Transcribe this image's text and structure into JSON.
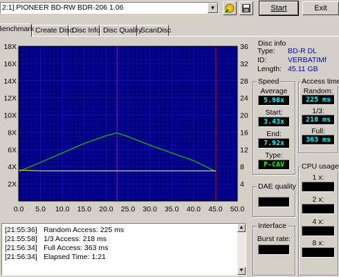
{
  "toolbar": {
    "drive": "2:1]  PIONEER BD-RW   BDR-206 1.06",
    "start_label": "Start",
    "exit_label": "Exit"
  },
  "tabs": [
    "Benchmark",
    "Create Disc",
    "Disc Info",
    "Disc Quality",
    "ScanDisc"
  ],
  "disc_info": {
    "title": "Disc info",
    "type_label": "Type:",
    "type_value": "BD-R DL",
    "id_label": "ID:",
    "id_value": "VERBATIMf",
    "length_label": "Length:",
    "length_value": "45.11 GB"
  },
  "speed": {
    "title": "Speed",
    "average_label": "Average",
    "average_value": "5.98x",
    "start_label": "Start:",
    "start_value": "3.43x",
    "end_label": "End:",
    "end_value": "7.92x",
    "type_label": "Type:",
    "type_value": "P-CAV"
  },
  "access": {
    "title": "Access times",
    "random_label": "Random:",
    "random_value": "225 ms",
    "third_label": "1/3:",
    "third_value": "218 ms",
    "full_label": "Full:",
    "full_value": "363 ms"
  },
  "dae": {
    "title": "DAE quality"
  },
  "interface": {
    "title": "Interface",
    "burst_label": "Burst rate:"
  },
  "cpu": {
    "title": "CPU usage",
    "l1": "1 x:",
    "l2": "2 x:",
    "l4": "4 x:",
    "l8": "8 x:"
  },
  "log": [
    {
      "time": "[21:55:36]",
      "text": "Random Access: 225 ms"
    },
    {
      "time": "[21:55:58]",
      "text": "1/3 Access: 218 ms"
    },
    {
      "time": "[21:56:34]",
      "text": "Full Access: 363 ms"
    },
    {
      "time": "[21:56:34]",
      "text": "Elapsed Time:  1:21"
    }
  ],
  "icons": [
    "disc-swap-icon",
    "eject-icon",
    "save-icon"
  ],
  "colors": {
    "plot_bg": "#000080",
    "grid": "#2020d0",
    "speed_line": "#00d000",
    "rpm_line": "#e0e000",
    "marker": "#c000c0",
    "end_marker": "#c00000"
  },
  "chart_data": {
    "type": "line",
    "xlim": [
      0,
      50
    ],
    "ylim_left": [
      0,
      18
    ],
    "ylim_right": [
      0,
      36
    ],
    "x_ticks": [
      "0.0",
      "5.0",
      "10.0",
      "15.0",
      "20.0",
      "25.0",
      "30.0",
      "35.0",
      "40.0",
      "45.0",
      "50.0"
    ],
    "y_left_ticks": [
      "2X",
      "4X",
      "6X",
      "8X",
      "10X",
      "12X",
      "14X",
      "16X",
      "18X"
    ],
    "y_right_ticks": [
      "4",
      "8",
      "12",
      "16",
      "20",
      "24",
      "28",
      "32",
      "36"
    ],
    "series": [
      {
        "x": [
          0,
          5,
          10,
          15,
          20,
          22.5,
          25,
          30,
          35,
          40,
          45.1
        ],
        "values": [
          3.43,
          4.5,
          5.6,
          6.7,
          7.6,
          7.92,
          7.5,
          6.5,
          5.6,
          4.7,
          3.43
        ]
      },
      {
        "x": [
          0,
          5,
          10,
          15,
          20,
          25,
          30,
          35,
          40,
          45.1
        ],
        "values": [
          3.6,
          3.5,
          3.5,
          3.5,
          3.5,
          3.5,
          3.5,
          3.5,
          3.5,
          3.5
        ]
      }
    ],
    "markers_x": [
      22.5,
      45.1
    ]
  }
}
